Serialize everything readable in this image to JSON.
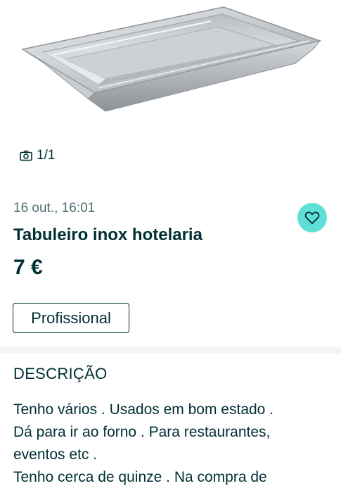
{
  "gallery": {
    "counter": "1/1"
  },
  "listing": {
    "date": "16 out., 16:01",
    "title": "Tabuleiro inox hotelaria",
    "price": "7 €",
    "tag": "Profissional",
    "favorite_icon": "heart-icon"
  },
  "description": {
    "header": "DESCRIÇÃO",
    "lines": [
      "Tenho vários . Usados em bom estado .",
      "Dá para ir ao forno . Para restaurantes,",
      "eventos etc .",
      "Tenho cerca de quinze . Na compra de"
    ]
  },
  "colors": {
    "text": "#002f34",
    "muted": "#4d6e72",
    "accent": "#5ee0d6",
    "divider": "#f2f4f5"
  }
}
